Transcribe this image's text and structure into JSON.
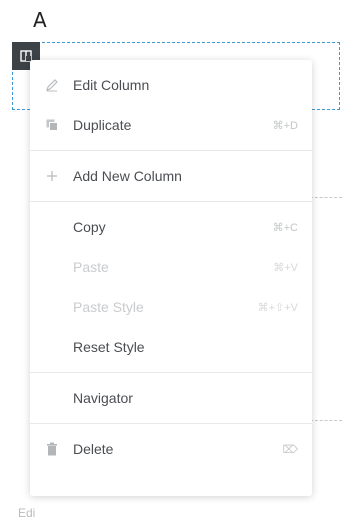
{
  "figure_label": "A",
  "background_fragment": "Edi",
  "menu": {
    "groups": [
      {
        "items": [
          {
            "label": "Edit Column",
            "icon": "pencil-icon",
            "shortcut": "",
            "enabled": true
          },
          {
            "label": "Duplicate",
            "icon": "duplicate-icon",
            "shortcut": "⌘+D",
            "enabled": true
          }
        ]
      },
      {
        "items": [
          {
            "label": "Add New Column",
            "icon": "plus-icon",
            "shortcut": "",
            "enabled": true
          }
        ]
      },
      {
        "items": [
          {
            "label": "Copy",
            "icon": "",
            "shortcut": "⌘+C",
            "enabled": true
          },
          {
            "label": "Paste",
            "icon": "",
            "shortcut": "⌘+V",
            "enabled": false
          },
          {
            "label": "Paste Style",
            "icon": "",
            "shortcut": "⌘+⇧+V",
            "enabled": false
          },
          {
            "label": "Reset Style",
            "icon": "",
            "shortcut": "",
            "enabled": true
          }
        ]
      },
      {
        "items": [
          {
            "label": "Navigator",
            "icon": "",
            "shortcut": "",
            "enabled": true
          }
        ]
      },
      {
        "items": [
          {
            "label": "Delete",
            "icon": "trash-icon",
            "shortcut": "⌦",
            "enabled": true
          }
        ]
      }
    ]
  },
  "colors": {
    "column_outline": "#3c9bd6",
    "column_handle": "#3d4247",
    "menu_text": "#4a4d52",
    "menu_text_disabled": "#c9cbcd"
  }
}
